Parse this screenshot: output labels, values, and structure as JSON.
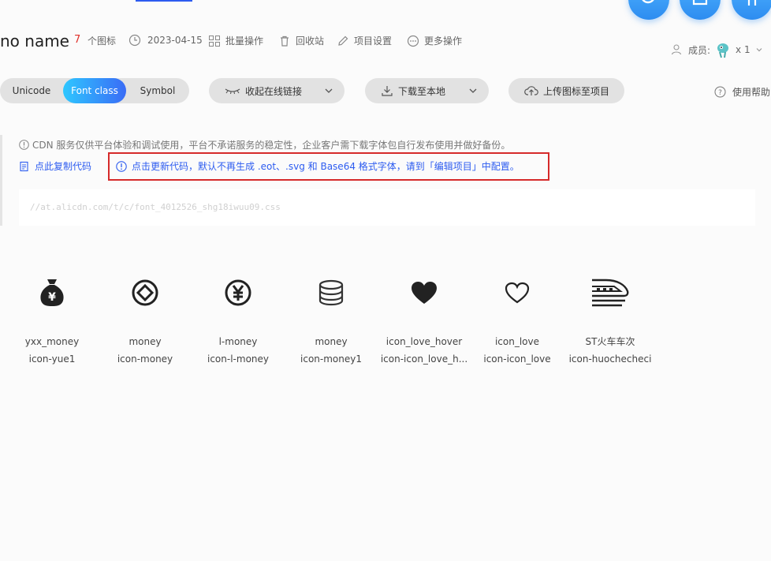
{
  "project": {
    "title": "no name",
    "icon_count": "7",
    "icon_count_label": "个图标",
    "date": "2023-04-15",
    "batch_label": "批量操作",
    "recycle_label": "回收站",
    "settings_label": "项目设置",
    "more_label": "更多操作",
    "members_label": "成员:",
    "members_count": "x 1"
  },
  "tabs": {
    "unicode": "Unicode",
    "font_class": "Font class",
    "symbol": "Symbol",
    "active": "Font class"
  },
  "toolbar": {
    "online_link": "收起在线链接",
    "download": "下载至本地",
    "upload": "上传图标至项目",
    "help": "使用帮助"
  },
  "notice": {
    "cdn_text": "CDN 服务仅供平台体验和调试使用，平台不承诺服务的稳定性，企业客户需下载字体包自行发布使用并做好备份。",
    "copy_code": "点此复制代码",
    "update_text": "点击更新代码，默认不再生成 .eot、.svg 和 Base64 格式字体，请到「编辑项目」中配置。",
    "code_url": "//at.alicdn.com/t/c/font_4012526_shg18iwuu09.css"
  },
  "icons": [
    {
      "name": "yxx_money",
      "class": "icon-yue1",
      "icon": "money-bag-icon"
    },
    {
      "name": "money",
      "class": "icon-money",
      "icon": "coin-diamond-icon"
    },
    {
      "name": "l-money",
      "class": "icon-l-money",
      "icon": "yen-circle-icon"
    },
    {
      "name": "money",
      "class": "icon-money1",
      "icon": "coin-stack-icon"
    },
    {
      "name": "icon_love_hover",
      "class": "icon-icon_love_h...",
      "icon": "heart-filled-icon"
    },
    {
      "name": "icon_love",
      "class": "icon-icon_love",
      "icon": "heart-outline-icon"
    },
    {
      "name": "ST火车车次",
      "class": "icon-huochecheci",
      "icon": "train-icon"
    }
  ],
  "colors": {
    "accent": "#2d5cf0",
    "count": "#e0302a",
    "highlight_border": "#d62a2a",
    "tab_gradient_start": "#2ec7ff",
    "tab_gradient_end": "#3a6cf6"
  }
}
